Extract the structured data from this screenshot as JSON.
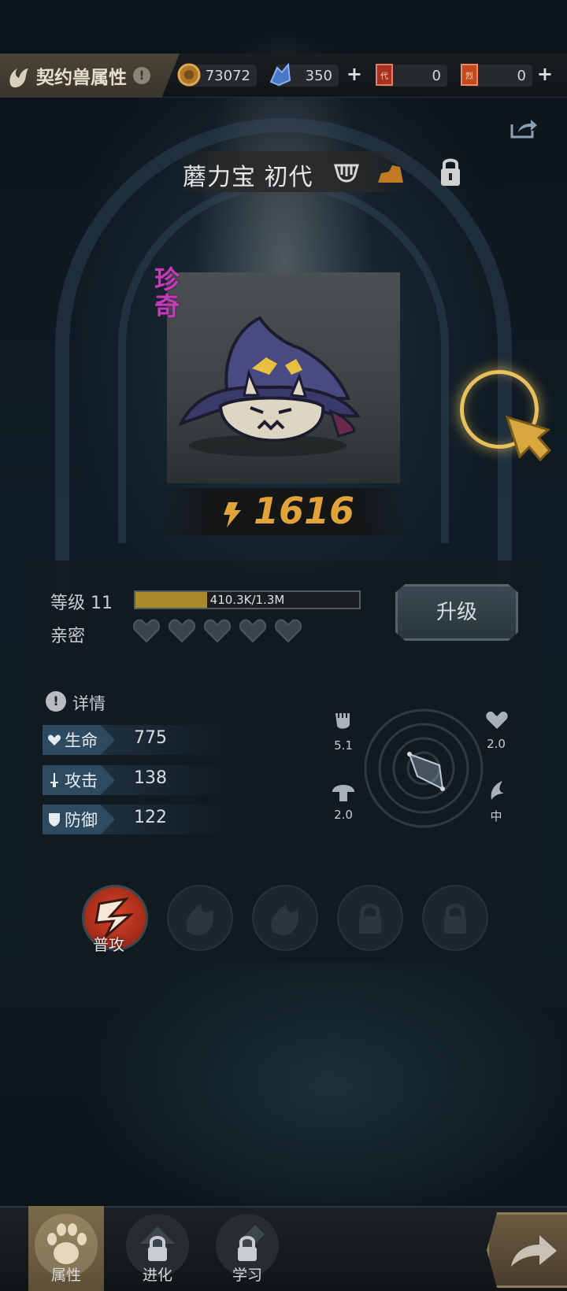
{
  "header": {
    "title": "契约兽属性",
    "info_icon": "exclamation-icon"
  },
  "resources": [
    {
      "name": "coin",
      "icon": "coin-icon",
      "value": "73072"
    },
    {
      "name": "crystal",
      "icon": "crystal-icon",
      "value": "350"
    },
    {
      "name": "ticket-a",
      "icon": "ticket-icon",
      "value": "0",
      "badge": "代"
    },
    {
      "name": "ticket-b",
      "icon": "ticket-icon",
      "value": "0",
      "badge": "烈"
    }
  ],
  "pet": {
    "name": "蘑力宝 初代",
    "rarity": "珍奇",
    "power": "1616"
  },
  "level": {
    "label": "等级 11",
    "xp_text": "410.3K/1.3M",
    "xp_progress": 0.32,
    "intimacy_label": "亲密",
    "hearts": 5,
    "upgrade_label": "升级"
  },
  "details": {
    "title": "详情",
    "stats": [
      {
        "label": "生命",
        "value": "775",
        "icon": "heart-icon"
      },
      {
        "label": "攻击",
        "value": "138",
        "icon": "sword-icon"
      },
      {
        "label": "防御",
        "value": "122",
        "icon": "shield-icon"
      }
    ],
    "radar": {
      "fist": "5.1",
      "heart": "2.0",
      "mushroom": "2.0",
      "wing": "中"
    }
  },
  "skills": {
    "first_label": "普攻"
  },
  "nav": {
    "tabs": [
      {
        "label": "属性",
        "active": true
      },
      {
        "label": "进化",
        "active": false
      },
      {
        "label": "学习",
        "active": false
      }
    ]
  },
  "colors": {
    "accent_gold": "#e0a43a",
    "rarity_purple": "#c23bb8",
    "xp_fill": "#a88a2a"
  }
}
